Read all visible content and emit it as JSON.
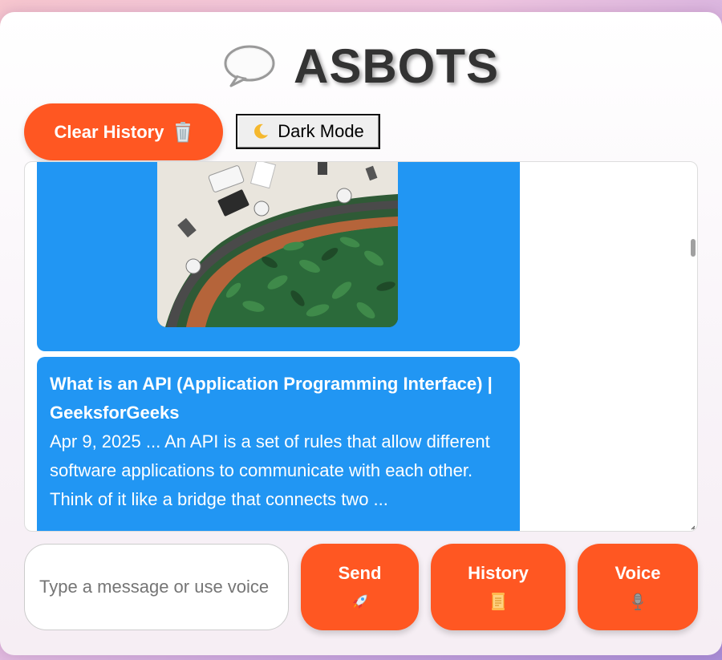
{
  "header": {
    "title": "ASBOTS",
    "title_icon": "speech-bubble-icon"
  },
  "toolbar": {
    "clear_label": "Clear History",
    "clear_icon": "trash-icon",
    "dark_mode_label": "Dark Mode",
    "dark_mode_icon": "moon-icon"
  },
  "chat": {
    "messages": [
      {
        "type": "image",
        "image_description_icon": "office-photo"
      },
      {
        "type": "search-result",
        "title": "What is an API (Application Programming Interface) | GeeksforGeeks",
        "snippet": "Apr 9, 2025 ... An API is a set of rules that allow different software applications to communicate with each other. Think of it like a bridge that connects two ..."
      }
    ]
  },
  "composer": {
    "placeholder": "Type a message or use voice",
    "value": ""
  },
  "actions": {
    "send_label": "Send",
    "send_icon": "rocket-icon",
    "history_label": "History",
    "history_icon": "scroll-icon",
    "voice_label": "Voice",
    "voice_icon": "microphone-icon"
  },
  "colors": {
    "accent": "#ff5722",
    "bubble": "#2196f3",
    "title_text": "#333333"
  }
}
